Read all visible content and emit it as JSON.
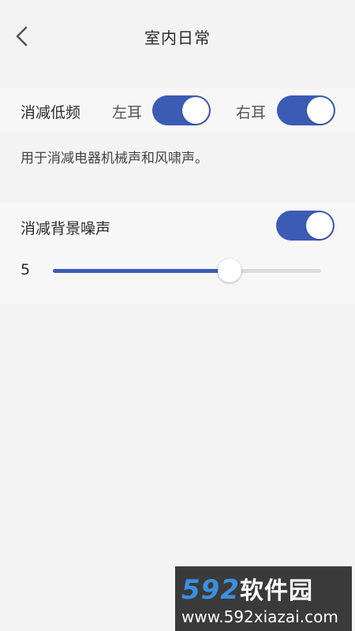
{
  "header": {
    "title": "室内日常",
    "back_icon": "chevron-left-icon"
  },
  "low_freq": {
    "label": "消减低频",
    "left_ear": {
      "label": "左耳",
      "on": true
    },
    "right_ear": {
      "label": "右耳",
      "on": true
    },
    "description": "用于消减电器机械声和风啸声。"
  },
  "background_noise": {
    "label": "消减背景噪声",
    "on": true,
    "level_label": "5",
    "level_fraction": 0.66
  },
  "colors": {
    "accent": "#3b5bb5",
    "track": "#dcdcdc",
    "background": "#f3f3f3",
    "row_bg": "#f7f7f7"
  },
  "watermark": {
    "logo_num": "592",
    "logo_cn": "软件园",
    "url": "www.592xiazai.com"
  }
}
